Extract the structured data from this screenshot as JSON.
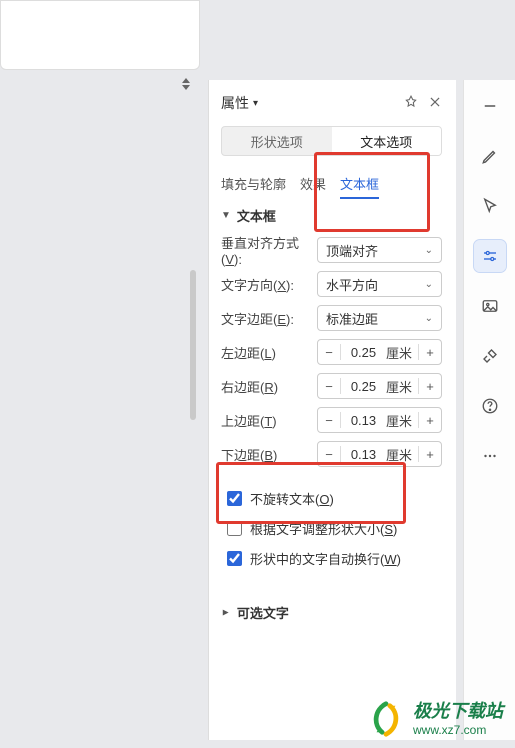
{
  "panel": {
    "title": "属性",
    "tabs": {
      "shape": "形状选项",
      "text": "文本选项"
    },
    "subtabs": {
      "fill": "填充与轮廓",
      "effect": "效果",
      "textbox": "文本框"
    }
  },
  "section_textbox": {
    "title": "文本框",
    "rows": {
      "valign": {
        "label_pre": "垂直对齐方式(",
        "label_u": "V",
        "label_post": "):",
        "value": "顶端对齐"
      },
      "tdir": {
        "label_pre": "文字方向(",
        "label_u": "X",
        "label_post": "):",
        "value": "水平方向"
      },
      "tmargin": {
        "label_pre": "文字边距(",
        "label_u": "E",
        "label_post": "):",
        "value": "标准边距"
      }
    },
    "margins": {
      "left": {
        "label_pre": "左边距(",
        "label_u": "L",
        "label_post": ")",
        "value": "0.25",
        "unit": "厘米"
      },
      "right": {
        "label_pre": "右边距(",
        "label_u": "R",
        "label_post": ")",
        "value": "0.25",
        "unit": "厘米"
      },
      "top": {
        "label_pre": "上边距(",
        "label_u": "T",
        "label_post": ")",
        "value": "0.13",
        "unit": "厘米"
      },
      "bottom": {
        "label_pre": "下边距(",
        "label_u": "B",
        "label_post": ")",
        "value": "0.13",
        "unit": "厘米"
      }
    },
    "checks": {
      "norotate": {
        "label_pre": "不旋转文本(",
        "label_u": "O",
        "label_post": ")",
        "checked": true
      },
      "autosize": {
        "label_pre": "根据文字调整形状大小(",
        "label_u": "S",
        "label_post": ")",
        "checked": false
      },
      "autowrap": {
        "label_pre": "形状中的文字自动换行(",
        "label_u": "W",
        "label_post": ")",
        "checked": true
      }
    }
  },
  "section_alttext": {
    "title": "可选文字"
  },
  "watermark": {
    "name": "极光下载站",
    "url": "www.xz7.com"
  },
  "spin": {
    "minus": "−",
    "plus": "+"
  }
}
